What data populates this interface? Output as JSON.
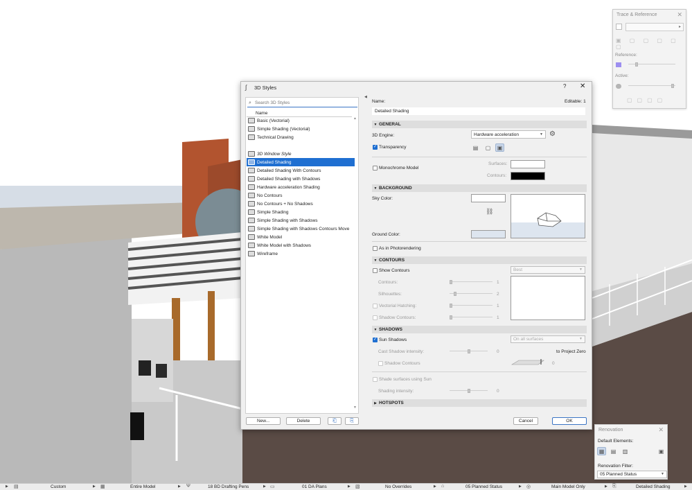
{
  "dialog": {
    "title": "3D Styles",
    "help": "?",
    "close": "✕",
    "search_placeholder": "Search 3D Styles",
    "list_header": "Name",
    "styles_group1": [
      "Basic (Vectorial)",
      "Simple Shading (Vectorial)",
      "Technical Drawing"
    ],
    "styles_group2": [
      "3D Window Style",
      "Detailed Shading",
      "Detailed Shading With Contours",
      "Detailed Shading with Shadows",
      "Hardware acceleration Shading",
      "No Contours",
      "No Contours + No Shadows",
      "Simple Shading",
      "Simple Shading with Shadows",
      "Simple Shading with Shadows Contours Move",
      "White Model",
      "White Model with Shadows",
      "Wireframe"
    ],
    "selected_style": "Detailed Shading",
    "new_button": "New...",
    "delete_button": "Delete",
    "cancel_button": "Cancel",
    "ok_button": "OK",
    "name_label": "Name:",
    "editable_label": "Editable: 1",
    "name_value": "Detailed Shading",
    "general": {
      "header": "GENERAL",
      "engine_label": "3D Engine:",
      "engine_value": "Hardware acceleration",
      "transparency": "Transparency",
      "monochrome": "Monochrome Model",
      "surfaces": "Surfaces:",
      "contours": "Contours:"
    },
    "background": {
      "header": "BACKGROUND",
      "sky": "Sky Color:",
      "ground": "Ground Color:",
      "photorendering": "As in Photorendering"
    },
    "contours_section": {
      "header": "CONTOURS",
      "show": "Show Contours",
      "quality": "Best",
      "contours": "Contours:",
      "contours_val": "1",
      "silhouettes": "Silhouettes:",
      "silhouettes_val": "2",
      "vectorial_hatching": "Vectorial Hatching:",
      "vectorial_hatching_val": "1",
      "shadow_contours": "Shadow Contours:",
      "shadow_contours_val": "1"
    },
    "shadows": {
      "header": "SHADOWS",
      "sun_shadows": "Sun Shadows",
      "surfaces_option": "On all surfaces",
      "cast_intensity": "Cast Shadow intensity:",
      "cast_val": "0",
      "to_project_zero": "to Project Zero",
      "shadow_contours": "Shadow Contours",
      "elev_val": "0",
      "shade_surfaces": "Shade surfaces using Sun",
      "shading_intensity": "Shading intensity:",
      "shading_val": "0"
    },
    "hotspots": {
      "header": "HOTSPOTS"
    }
  },
  "trace_palette": {
    "title": "Trace & Reference",
    "reference": "Reference:",
    "active": "Active:"
  },
  "renovation_palette": {
    "title": "Renovation",
    "default_elements": "Default Elements:",
    "filter_label": "Renovation Filter:",
    "filter_value": "05 Planned Status"
  },
  "statusbar": {
    "items": [
      "Custom",
      "Entire Model",
      "18 BD Drafting Pens",
      "01 DA Plans",
      "No Overrides",
      "05 Planned Status",
      "Main Model Only",
      "Detailed Shading"
    ]
  },
  "colors": {
    "accent": "#1f6fd1",
    "contours_swatch": "#000000",
    "surfaces_swatch": "#ffffff",
    "ground_swatch": "#dde5ef"
  }
}
